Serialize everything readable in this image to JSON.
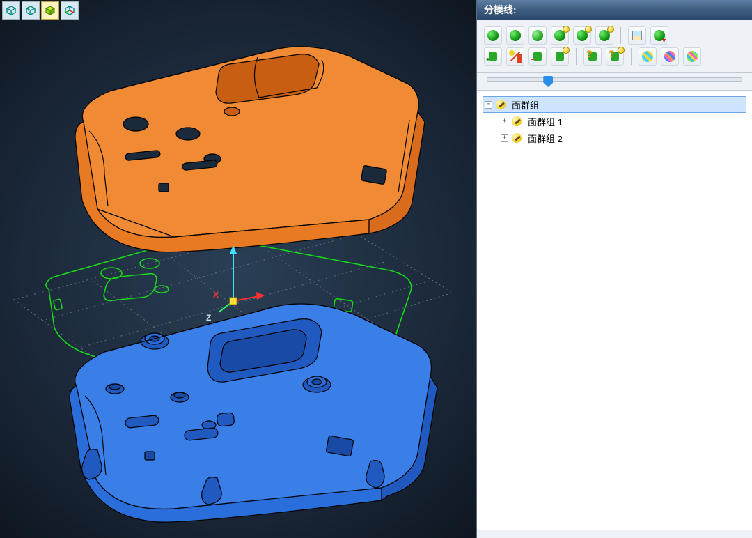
{
  "view_toolbar": {
    "buttons": [
      {
        "name": "cube-wire-1-icon",
        "color": "#2aa8a0"
      },
      {
        "name": "cube-wire-2-icon",
        "color": "#2aa8a0"
      },
      {
        "name": "cube-shaded-icon",
        "color": "#b8f020",
        "selected": true
      },
      {
        "name": "cube-axis-icon",
        "color": "#2aa8a0"
      }
    ]
  },
  "panel": {
    "title": "分模线:",
    "toolbar_row1": [
      {
        "name": "sphere-green-1-icon"
      },
      {
        "name": "sphere-green-2-icon"
      },
      {
        "name": "sphere-green-lines-icon"
      },
      {
        "name": "sphere-green-smile-1-icon"
      },
      {
        "name": "sphere-green-smile-2-icon"
      },
      {
        "name": "sphere-green-smile-3-icon"
      },
      {
        "name": "split-doc-icon"
      },
      {
        "name": "sphere-green-down-icon"
      }
    ],
    "toolbar_row2": [
      {
        "name": "plus-green-cube-icon"
      },
      {
        "name": "slash-red-dot-icon"
      },
      {
        "name": "minus-green-cube-icon"
      },
      {
        "name": "smile-green-cube-icon"
      },
      {
        "name": "question-cube-1-icon"
      },
      {
        "name": "question-cube-2-icon"
      },
      {
        "name": "stripes-sphere-1-icon"
      },
      {
        "name": "stripes-sphere-2-icon"
      },
      {
        "name": "stripes-sphere-3-icon"
      }
    ],
    "slider": {
      "value_percent": 22
    },
    "tree": {
      "root": {
        "label": "面群组",
        "expanded": true
      },
      "children": [
        {
          "label": "面群组 1",
          "expanded": false
        },
        {
          "label": "面群组 2",
          "expanded": false
        }
      ]
    }
  },
  "viewport": {
    "axis_labels": {
      "x": "X",
      "z": "Z"
    }
  },
  "colors": {
    "panel_title_bg": "#3f5d80",
    "bg_dark": "#1a2a3a",
    "top_part": "#e87a24",
    "bottom_part": "#2a6edc",
    "wire_green": "#18d818"
  }
}
